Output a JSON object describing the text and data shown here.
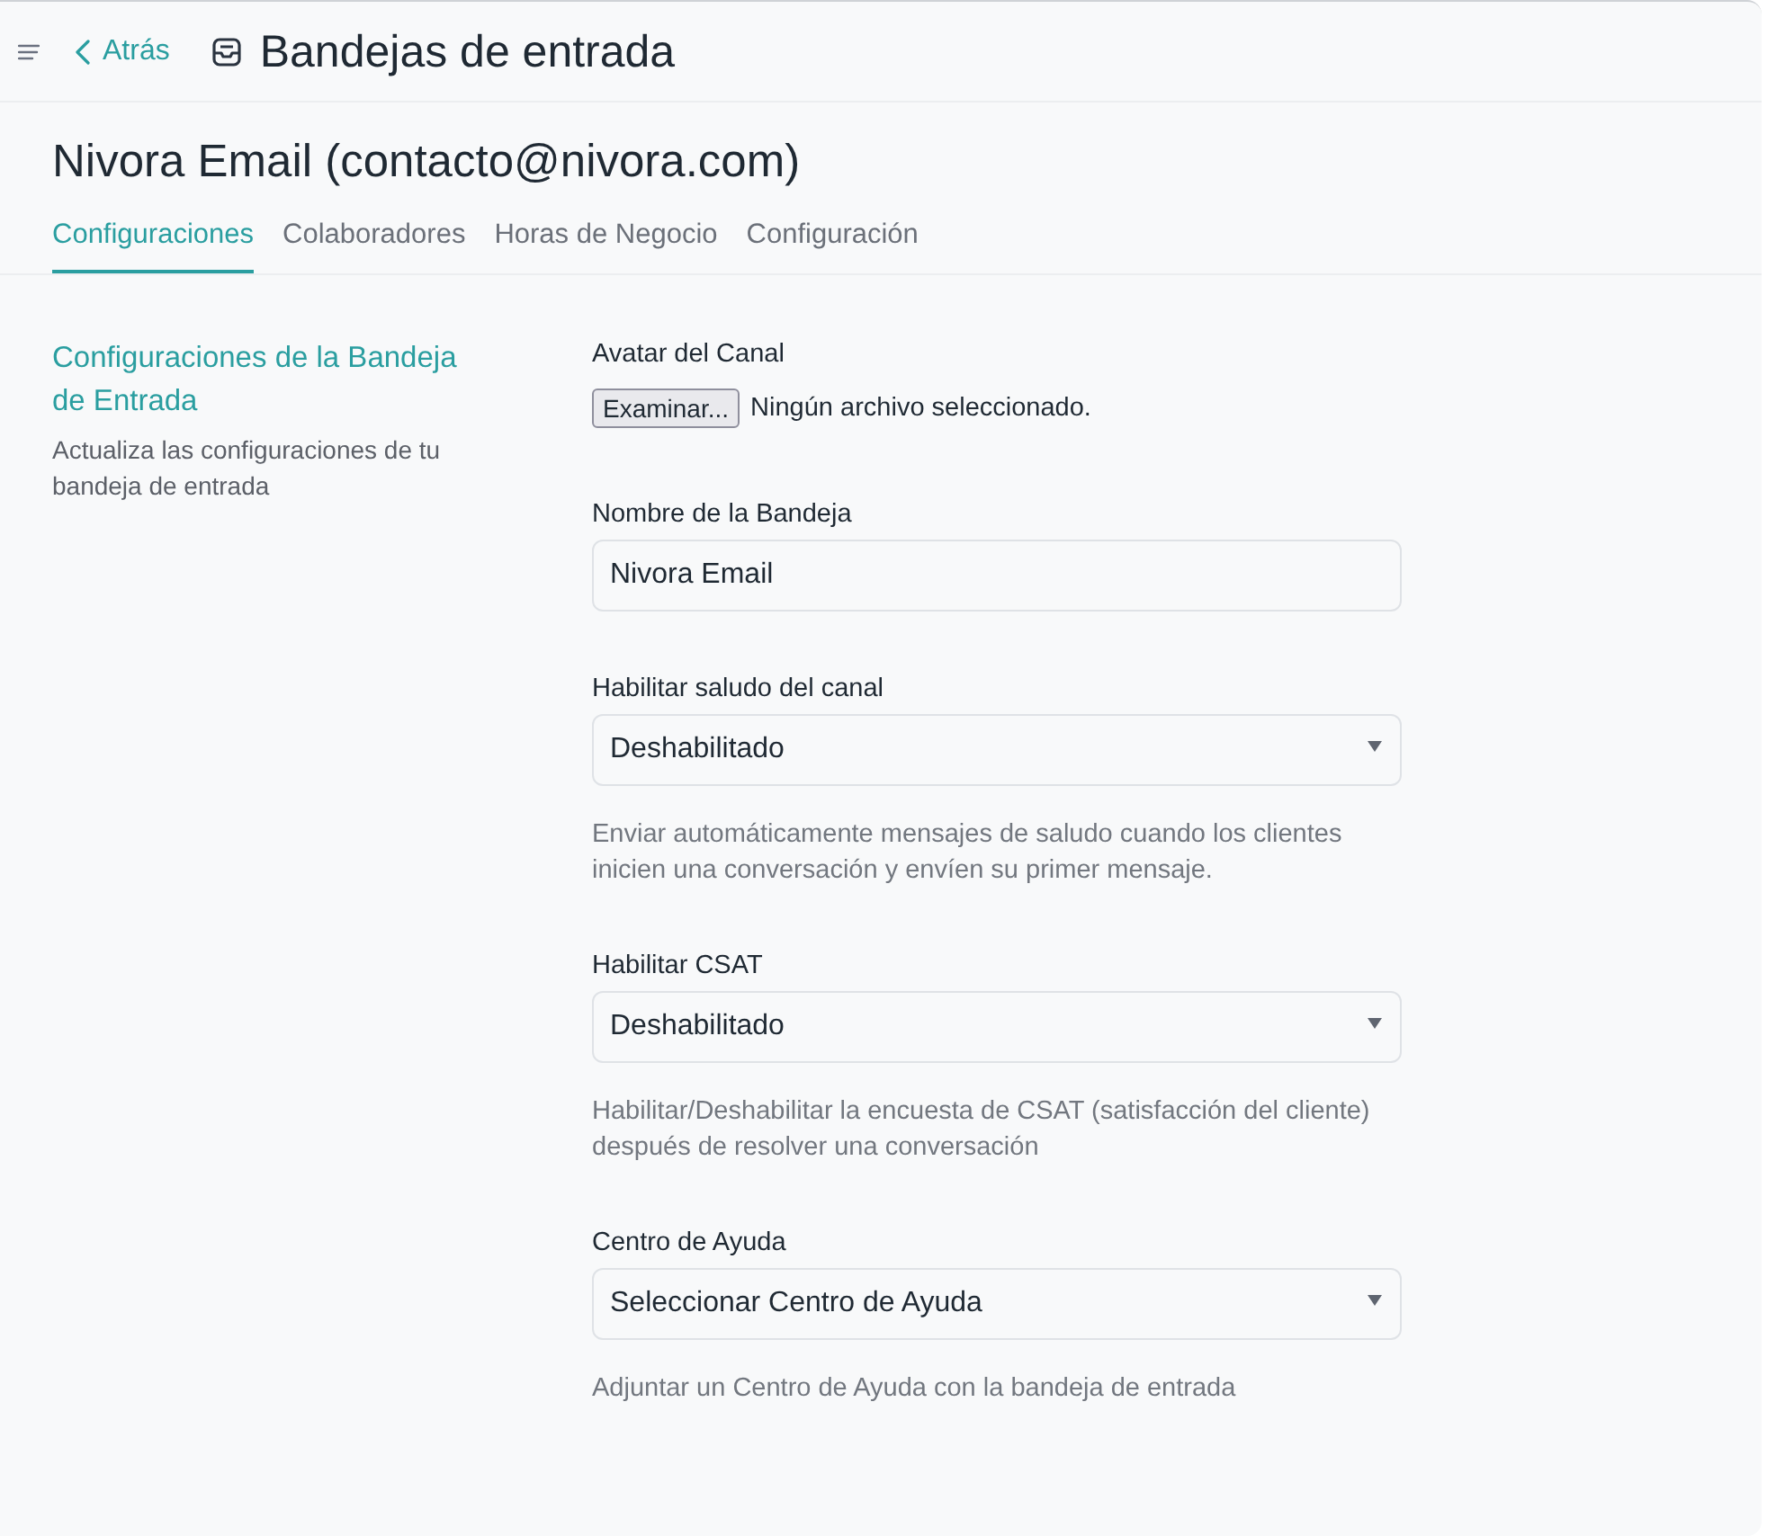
{
  "header": {
    "back_label": "Atrás",
    "title": "Bandejas de entrada"
  },
  "inbox": {
    "title": "Nivora Email (contacto@nivora.com)"
  },
  "tabs": [
    {
      "label": "Configuraciones",
      "selected": true
    },
    {
      "label": "Colaboradores",
      "selected": false
    },
    {
      "label": "Horas de Negocio",
      "selected": false
    },
    {
      "label": "Configuración",
      "selected": false
    }
  ],
  "section": {
    "title": "Configuraciones de la Bandeja de Entrada",
    "description": "Actualiza las configuraciones de tu bandeja de entrada"
  },
  "fields": [
    {
      "kind": "file",
      "label": "Avatar del Canal",
      "button": "Examinar...",
      "value": "Ningún archivo seleccionado."
    },
    {
      "kind": "text",
      "label": "Nombre de la Bandeja",
      "value": "Nivora Email"
    },
    {
      "kind": "select",
      "label": "Habilitar saludo del canal",
      "value": "Deshabilitado",
      "help": "Enviar automáticamente mensajes de saludo cuando los clientes inicien una conversación y envíen su primer mensaje."
    },
    {
      "kind": "select",
      "label": "Habilitar CSAT",
      "value": "Deshabilitado",
      "help": "Habilitar/Deshabilitar la encuesta de CSAT (satisfacción del cliente) después de resolver una conversación"
    },
    {
      "kind": "select",
      "label": "Centro de Ayuda",
      "value": "Seleccionar Centro de Ayuda",
      "help": "Adjuntar un Centro de Ayuda con la bandeja de entrada"
    }
  ]
}
